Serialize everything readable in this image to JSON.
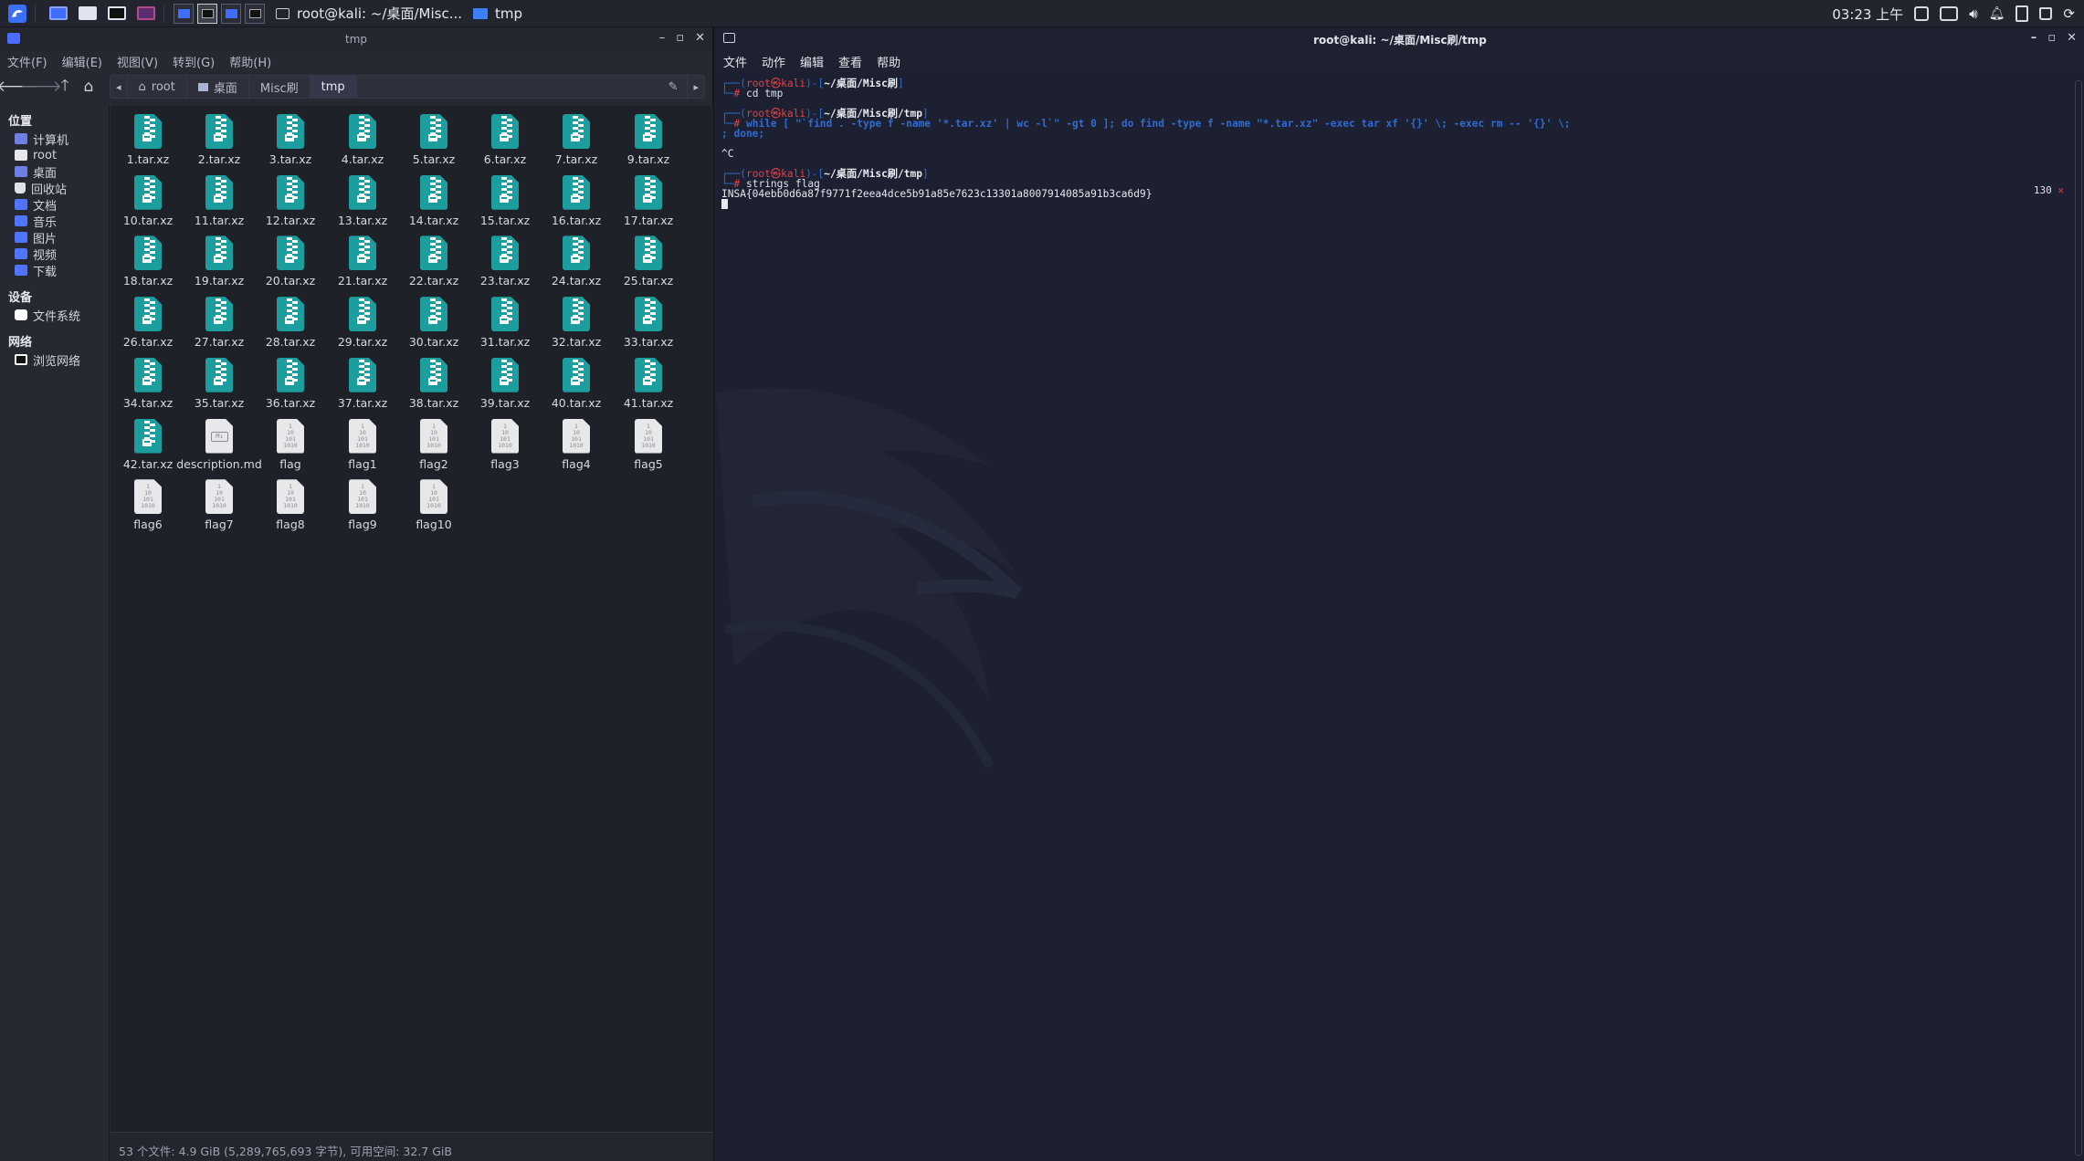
{
  "taskbar": {
    "tasks": [
      {
        "label": "root@kali: ~/桌面/Misc..."
      },
      {
        "label": "tmp"
      }
    ],
    "clock": "03:23 上午"
  },
  "file_manager": {
    "title": "tmp",
    "menu": [
      "文件(F)",
      "编辑(E)",
      "视图(V)",
      "转到(G)",
      "帮助(H)"
    ],
    "breadcrumb": [
      "root",
      "桌面",
      "Misc刷",
      "tmp"
    ],
    "sidebar": {
      "places_header": "位置",
      "places": [
        "计算机",
        "root",
        "桌面",
        "回收站",
        "文档",
        "音乐",
        "图片",
        "视频",
        "下载"
      ],
      "devices_header": "设备",
      "devices": [
        "文件系统"
      ],
      "network_header": "网络",
      "network": [
        "浏览网络"
      ]
    },
    "files": [
      {
        "name": "1.tar.xz",
        "type": "archive"
      },
      {
        "name": "2.tar.xz",
        "type": "archive"
      },
      {
        "name": "3.tar.xz",
        "type": "archive"
      },
      {
        "name": "4.tar.xz",
        "type": "archive"
      },
      {
        "name": "5.tar.xz",
        "type": "archive"
      },
      {
        "name": "6.tar.xz",
        "type": "archive"
      },
      {
        "name": "7.tar.xz",
        "type": "archive"
      },
      {
        "name": "9.tar.xz",
        "type": "archive"
      },
      {
        "name": "10.tar.xz",
        "type": "archive"
      },
      {
        "name": "11.tar.xz",
        "type": "archive"
      },
      {
        "name": "12.tar.xz",
        "type": "archive"
      },
      {
        "name": "13.tar.xz",
        "type": "archive"
      },
      {
        "name": "14.tar.xz",
        "type": "archive"
      },
      {
        "name": "15.tar.xz",
        "type": "archive"
      },
      {
        "name": "16.tar.xz",
        "type": "archive"
      },
      {
        "name": "17.tar.xz",
        "type": "archive"
      },
      {
        "name": "18.tar.xz",
        "type": "archive"
      },
      {
        "name": "19.tar.xz",
        "type": "archive"
      },
      {
        "name": "20.tar.xz",
        "type": "archive"
      },
      {
        "name": "21.tar.xz",
        "type": "archive"
      },
      {
        "name": "22.tar.xz",
        "type": "archive"
      },
      {
        "name": "23.tar.xz",
        "type": "archive"
      },
      {
        "name": "24.tar.xz",
        "type": "archive"
      },
      {
        "name": "25.tar.xz",
        "type": "archive"
      },
      {
        "name": "26.tar.xz",
        "type": "archive"
      },
      {
        "name": "27.tar.xz",
        "type": "archive"
      },
      {
        "name": "28.tar.xz",
        "type": "archive"
      },
      {
        "name": "29.tar.xz",
        "type": "archive"
      },
      {
        "name": "30.tar.xz",
        "type": "archive"
      },
      {
        "name": "31.tar.xz",
        "type": "archive"
      },
      {
        "name": "32.tar.xz",
        "type": "archive"
      },
      {
        "name": "33.tar.xz",
        "type": "archive"
      },
      {
        "name": "34.tar.xz",
        "type": "archive"
      },
      {
        "name": "35.tar.xz",
        "type": "archive"
      },
      {
        "name": "36.tar.xz",
        "type": "archive"
      },
      {
        "name": "37.tar.xz",
        "type": "archive"
      },
      {
        "name": "38.tar.xz",
        "type": "archive"
      },
      {
        "name": "39.tar.xz",
        "type": "archive"
      },
      {
        "name": "40.tar.xz",
        "type": "archive"
      },
      {
        "name": "41.tar.xz",
        "type": "archive"
      },
      {
        "name": "42.tar.xz",
        "type": "archive"
      },
      {
        "name": "description.md",
        "type": "markdown"
      },
      {
        "name": "flag",
        "type": "binary"
      },
      {
        "name": "flag1",
        "type": "binary"
      },
      {
        "name": "flag2",
        "type": "binary"
      },
      {
        "name": "flag3",
        "type": "binary"
      },
      {
        "name": "flag4",
        "type": "binary"
      },
      {
        "name": "flag5",
        "type": "binary"
      },
      {
        "name": "flag6",
        "type": "binary"
      },
      {
        "name": "flag7",
        "type": "binary"
      },
      {
        "name": "flag8",
        "type": "binary"
      },
      {
        "name": "flag9",
        "type": "binary"
      },
      {
        "name": "flag10",
        "type": "binary"
      }
    ],
    "binary_glyph": [
      "1",
      "10",
      "101",
      "1010"
    ],
    "markdown_glyph": "M↓",
    "status": "53 个文件: 4.9 GiB (5,289,765,693 字节), 可用空间: 32.7 GiB"
  },
  "terminal": {
    "title": "root@kali: ~/桌面/Misc刷/tmp",
    "menu": [
      "文件",
      "动作",
      "编辑",
      "查看",
      "帮助"
    ],
    "prompt_user": "root",
    "prompt_host": "kali",
    "prompt1_path": "~/桌面/Misc刷",
    "cmd1": "cd tmp",
    "prompt2_path": "~/桌面/Misc刷/tmp",
    "cmd2_line1": "while [ \"`find . -type f -name '*.tar.xz' | wc -l`\" -gt 0 ]; do find -type f -name \"*.tar.xz\" -exec tar xf '{}' \\; -exec rm -- '{}' \\;",
    "cmd2_line2": "; done;",
    "interrupt": "^C",
    "prompt3_path": "~/桌面/Misc刷/tmp",
    "cmd3": "strings flag",
    "exit_code": "130",
    "exit_mark": "✕",
    "output": "INSA{04ebb0d6a87f9771f2eea4dce5b91a85e7623c13301a8007914085a91b3ca6d9}"
  },
  "colors": {
    "accent": "#2f6bd6",
    "archive_icon": "#1c9e9e",
    "prompt_red": "#e0404a"
  }
}
